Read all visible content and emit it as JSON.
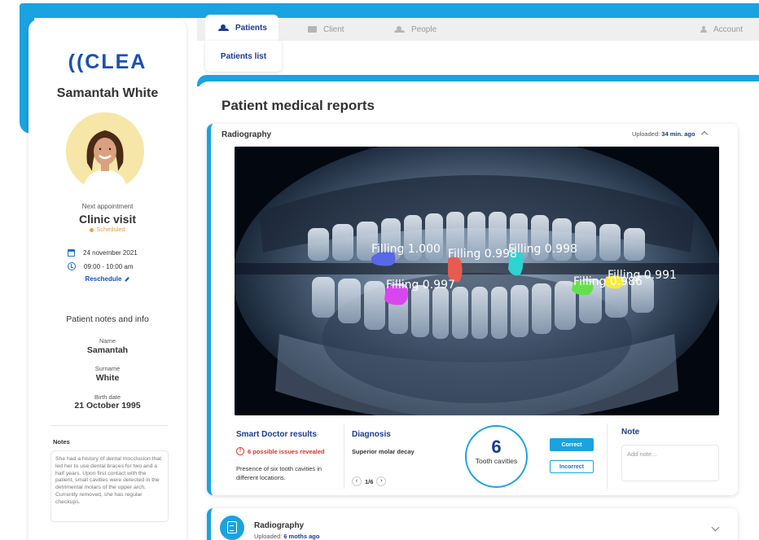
{
  "app": {
    "logo_text": "((CLEA"
  },
  "nav": {
    "tabs": [
      {
        "label": "Patients",
        "icon": "people-icon",
        "active": true
      },
      {
        "label": "Client",
        "icon": "briefcase-icon",
        "active": false
      },
      {
        "label": "People",
        "icon": "people-icon",
        "active": false
      }
    ],
    "account_label": "Account",
    "subtab_label": "Patients list"
  },
  "sidebar": {
    "patient_name": "Samantah White",
    "next_label": "Next appointment",
    "appointment_type": "Clinic visit",
    "appointment_status": "Scheduled",
    "date": "24 november 2021",
    "time": "09:00 - 10:00 am",
    "reschedule_label": "Reschedule",
    "notes_info_title": "Patient notes and info",
    "fields": [
      {
        "label": "Name",
        "value": "Samantah"
      },
      {
        "label": "Surname",
        "value": "White"
      },
      {
        "label": "Birth date",
        "value": "21 October 1995"
      }
    ],
    "notes_label": "Notes",
    "notes_text": "She had a history of dental mocclusion that led her to use dental braces for two and a half years. Upon first contact with the patient, small cavities were detected in the detrimental molars of the upper arch. Currently removed, she has regular checkups."
  },
  "main": {
    "page_title": "Patient medical reports",
    "card": {
      "title": "Radiography",
      "uploaded_prefix": "Uploaded:",
      "uploaded_value": "34 min. ago",
      "detections": [
        {
          "label": "Filling 1.000",
          "color": "#5a67e6"
        },
        {
          "label": "Filling 0.998",
          "color": "#e65c4f"
        },
        {
          "label": "Filling 0.998",
          "color": "#2fd3d1"
        },
        {
          "label": "Filling 0.997",
          "color": "#d946ef"
        },
        {
          "label": "Filling 0.986",
          "color": "#65e04a"
        },
        {
          "label": "Filling 0.991",
          "color": "#f5ec36"
        }
      ],
      "smart_doctor_title": "Smart Doctor results",
      "issues_text": "6 possible issues revealed",
      "presence_text": "Presence of six tooth cavities in different locations.",
      "diagnosis_title": "Diagnosis",
      "diagnosis_text": "Superior molar decay",
      "pager_text": "1/6",
      "count_value": "6",
      "count_label": "Tooth cavities",
      "correct_label": "Correct",
      "incorrect_label": "Incorrect",
      "note_title": "Note",
      "note_placeholder": "Add note..."
    },
    "card2": {
      "title": "Radiography",
      "uploaded_prefix": "Uploaded:",
      "uploaded_value": "6 moths ago"
    }
  },
  "colors": {
    "accent": "#1aa3e0",
    "brand": "#1a3a8f",
    "warning": "#d9302c",
    "scheduled": "#e7a14a"
  }
}
